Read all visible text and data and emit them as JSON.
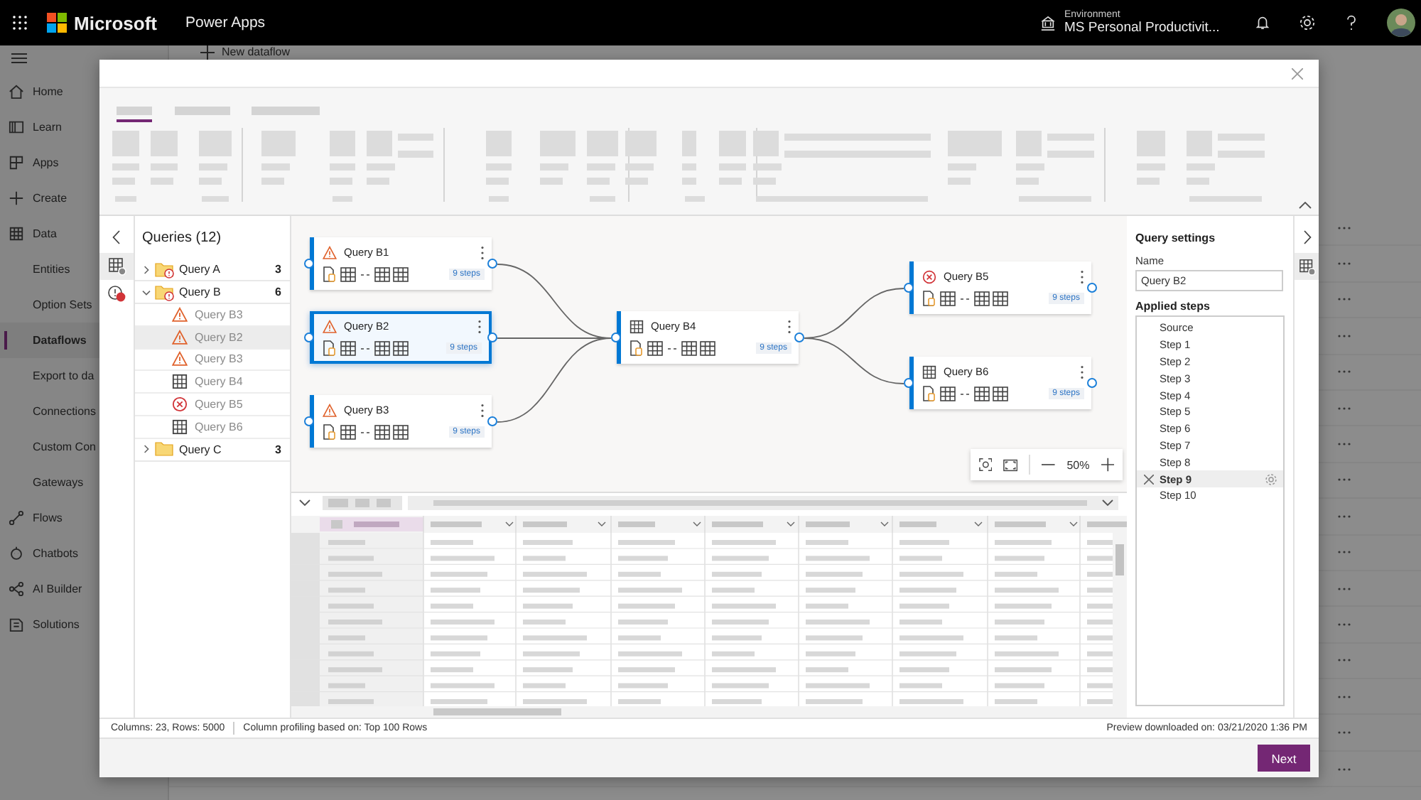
{
  "top_bar": {
    "brand": "Microsoft",
    "app": "Power Apps",
    "environment_label": "Environment",
    "environment": "MS Personal Productivit..."
  },
  "nav": [
    {
      "label": "Home",
      "kind": "home",
      "selected": false
    },
    {
      "label": "Learn",
      "kind": "learn",
      "selected": false
    },
    {
      "label": "Apps",
      "kind": "apps",
      "selected": false
    },
    {
      "label": "Create",
      "kind": "create",
      "selected": false
    },
    {
      "label": "Data",
      "kind": "data",
      "selected": false
    },
    {
      "label": "Entities",
      "selected": false
    },
    {
      "label": "Option Sets",
      "selected": false
    },
    {
      "label": "Dataflows",
      "selected": true
    },
    {
      "label": "Export to da",
      "selected": false
    },
    {
      "label": "Connections",
      "selected": false
    },
    {
      "label": "Custom Con",
      "selected": false
    },
    {
      "label": "Gateways",
      "selected": false
    },
    {
      "label": "Flows",
      "kind": "flows",
      "selected": false
    },
    {
      "label": "Chatbots",
      "kind": "chatbots",
      "selected": false
    },
    {
      "label": "AI Builder",
      "kind": "ai",
      "selected": false
    },
    {
      "label": "Solutions",
      "kind": "solutions",
      "selected": false
    }
  ],
  "page": {
    "command": "New dataflow"
  },
  "dialog": {
    "queries": {
      "title": "Queries (12)",
      "groups": [
        {
          "name": "Query A",
          "count": "3",
          "expanded": false,
          "warning": true
        },
        {
          "name": "Query B",
          "count": "6",
          "expanded": true,
          "warning": true,
          "children": [
            {
              "name": "Query B3",
              "kind": "warning",
              "selected": false
            },
            {
              "name": "Query B2",
              "kind": "warning",
              "selected": true
            },
            {
              "name": "Query B3",
              "kind": "warning",
              "selected": false
            },
            {
              "name": "Query B4",
              "kind": "table",
              "selected": false
            },
            {
              "name": "Query B5",
              "kind": "error",
              "selected": false
            },
            {
              "name": "Query B6",
              "kind": "table",
              "selected": false
            }
          ]
        },
        {
          "name": "Query C",
          "count": "3",
          "expanded": false,
          "warning": false
        }
      ]
    },
    "diagram": {
      "nodes": [
        {
          "title": "Query B1",
          "kind": "warning",
          "steps": "9 steps",
          "selected": false
        },
        {
          "title": "Query B2",
          "kind": "warning",
          "steps": "9 steps",
          "selected": true
        },
        {
          "title": "Query B3",
          "kind": "warning",
          "steps": "9 steps",
          "selected": false
        },
        {
          "title": "Query B4",
          "kind": "table",
          "steps": "9 steps",
          "selected": false
        },
        {
          "title": "Query B5",
          "kind": "error",
          "steps": "9 steps",
          "selected": false
        },
        {
          "title": "Query B6",
          "kind": "table",
          "steps": "9 steps",
          "selected": false
        }
      ],
      "zoom": "50%"
    },
    "settings": {
      "title": "Query settings",
      "name_label": "Name",
      "name_value": "Query B2",
      "steps_title": "Applied steps",
      "steps": [
        {
          "label": "Source",
          "selected": false
        },
        {
          "label": "Step 1",
          "selected": false
        },
        {
          "label": "Step 2",
          "selected": false
        },
        {
          "label": "Step 3",
          "selected": false
        },
        {
          "label": "Step 4",
          "selected": false
        },
        {
          "label": "Step 5",
          "selected": false
        },
        {
          "label": "Step 6",
          "selected": false
        },
        {
          "label": "Step 7",
          "selected": false
        },
        {
          "label": "Step 8",
          "selected": false
        },
        {
          "label": "Step 9",
          "selected": true
        },
        {
          "label": "Step 10",
          "selected": false
        }
      ]
    },
    "status_bar": {
      "size": "Columns: 23, Rows: 5000",
      "profiling": "Column profiling based on: Top 100 Rows",
      "preview": "Preview downloaded on: 03/21/2020 1:36 PM"
    },
    "next_button": {
      "label": "Next"
    }
  }
}
